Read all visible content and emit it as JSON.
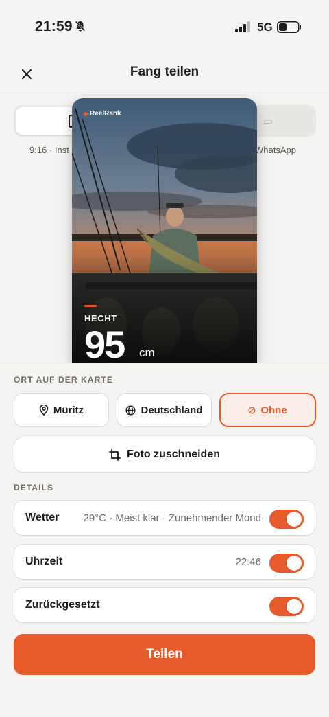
{
  "status_bar": {
    "time": "21:59",
    "network": "5G",
    "icons": [
      "bell-slash-icon",
      "signal-icon",
      "battery-icon"
    ]
  },
  "header": {
    "title": "Fang teilen",
    "close_icon": "close-icon"
  },
  "format_selector": {
    "left_label": "9:16 · Inst",
    "right_label": "WhatsApp"
  },
  "preview": {
    "brand": "ReelRank",
    "species": "HECHT",
    "length": "95",
    "unit": "cm"
  },
  "location": {
    "section_label": "ORT AUF DER KARTE",
    "options": [
      {
        "label": "Müritz",
        "icon": "pin-icon",
        "selected": false
      },
      {
        "label": "Deutschland",
        "icon": "globe-icon",
        "selected": false
      },
      {
        "label": "Ohne",
        "icon": "no-location-icon",
        "selected": true
      }
    ]
  },
  "crop": {
    "label": "Foto zuschneiden",
    "icon": "crop-icon"
  },
  "details": {
    "section_label": "DETAILS",
    "rows": [
      {
        "label": "Wetter",
        "value": "29°C · Meist klar · Zunehmender Mond",
        "enabled": true
      },
      {
        "label": "Uhrzeit",
        "value": "22:46",
        "enabled": true
      },
      {
        "label": "Zurückgesetzt",
        "value": "",
        "enabled": true
      }
    ]
  },
  "share": {
    "label": "Teilen"
  },
  "colors": {
    "accent": "#e95a2b",
    "background": "#f5f4f2",
    "card": "#ffffff"
  }
}
